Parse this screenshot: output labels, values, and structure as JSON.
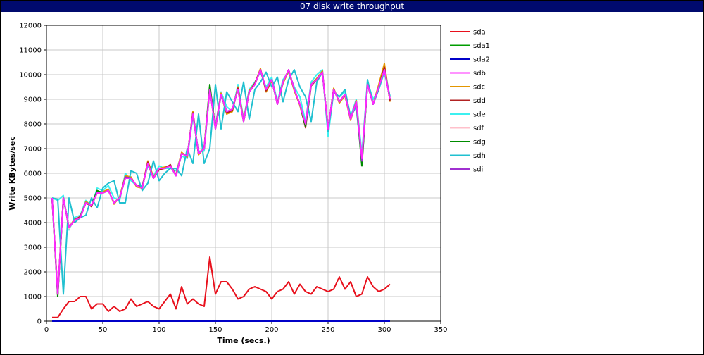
{
  "window": {
    "title": "07 disk write throughput"
  },
  "chart_data": {
    "type": "line",
    "title": "07 disk write throughput",
    "xlabel": "Time (secs.)",
    "ylabel": "Write KBytes/sec",
    "xlim": [
      0,
      350
    ],
    "ylim": [
      0,
      12000
    ],
    "xticks": [
      0,
      50,
      100,
      150,
      200,
      250,
      300,
      350
    ],
    "yticks": [
      0,
      1000,
      2000,
      3000,
      4000,
      5000,
      6000,
      7000,
      8000,
      9000,
      10000,
      11000,
      12000
    ],
    "grid": true,
    "legend_position": "right",
    "x": [
      5,
      10,
      15,
      20,
      25,
      30,
      35,
      40,
      45,
      50,
      55,
      60,
      65,
      70,
      75,
      80,
      85,
      90,
      95,
      100,
      105,
      110,
      115,
      120,
      125,
      130,
      135,
      140,
      145,
      150,
      155,
      160,
      165,
      170,
      175,
      180,
      185,
      190,
      195,
      200,
      205,
      210,
      215,
      220,
      225,
      230,
      235,
      240,
      245,
      250,
      255,
      260,
      265,
      270,
      275,
      280,
      285,
      290,
      295,
      300,
      305
    ],
    "series": [
      {
        "name": "sda",
        "color": "#e8101c",
        "values": [
          150,
          150,
          500,
          800,
          800,
          1000,
          1000,
          500,
          700,
          700,
          400,
          600,
          400,
          500,
          900,
          600,
          700,
          800,
          600,
          500,
          800,
          1100,
          500,
          1400,
          700,
          900,
          700,
          600,
          2600,
          1100,
          1600,
          1600,
          1300,
          900,
          1000,
          1300,
          1400,
          1300,
          1200,
          900,
          1200,
          1300,
          1600,
          1100,
          1500,
          1200,
          1100,
          1400,
          1300,
          1200,
          1300,
          1800,
          1300,
          1600,
          1000,
          1100,
          1800,
          1400,
          1200,
          1300,
          1500
        ]
      },
      {
        "name": "sda1",
        "color": "#009c00",
        "values": [
          0,
          0,
          0,
          0,
          0,
          0,
          0,
          0,
          0,
          0,
          0,
          0,
          0,
          0,
          0,
          0,
          0,
          0,
          0,
          0,
          0,
          0,
          0,
          0,
          0,
          0,
          0,
          0,
          0,
          0,
          0,
          0,
          0,
          0,
          0,
          0,
          0,
          0,
          0,
          0,
          0,
          0,
          0,
          0,
          0,
          0,
          0,
          0,
          0,
          0,
          0,
          0,
          0,
          0,
          0,
          0,
          0,
          0,
          0,
          0,
          0
        ]
      },
      {
        "name": "sda2",
        "color": "#0000c8",
        "values": [
          0,
          0,
          0,
          0,
          0,
          0,
          0,
          0,
          0,
          0,
          0,
          0,
          0,
          0,
          0,
          0,
          0,
          0,
          0,
          0,
          0,
          0,
          0,
          0,
          0,
          0,
          0,
          0,
          0,
          0,
          0,
          0,
          0,
          0,
          0,
          0,
          0,
          0,
          0,
          0,
          0,
          0,
          0,
          0,
          0,
          0,
          0,
          0,
          0,
          0,
          0,
          0,
          0,
          0,
          0,
          0,
          0,
          0,
          0,
          0,
          0
        ]
      },
      {
        "name": "sdb",
        "color": "#ff28ff",
        "values": [
          5000,
          1100,
          5000,
          3800,
          4100,
          4200,
          4800,
          4700,
          5200,
          5200,
          5300,
          4800,
          5000,
          5800,
          5800,
          5500,
          5400,
          6400,
          5800,
          6200,
          6200,
          6300,
          5900,
          6800,
          6700,
          8400,
          6800,
          7000,
          9400,
          7800,
          9200,
          8500,
          8600,
          9400,
          8100,
          9300,
          9600,
          10200,
          9400,
          9800,
          8800,
          9700,
          10200,
          9400,
          8800,
          8000,
          9600,
          9800,
          10100,
          7800,
          9400,
          8900,
          9200,
          8200,
          8900,
          6600,
          9600,
          8800,
          9500,
          10200,
          9000
        ]
      },
      {
        "name": "sdc",
        "color": "#e39600",
        "values": [
          5000,
          1150,
          5000,
          3800,
          4150,
          4200,
          4850,
          4700,
          5250,
          5250,
          5350,
          4750,
          5050,
          5900,
          5850,
          5450,
          5400,
          6500,
          5850,
          6200,
          6250,
          6300,
          5950,
          6850,
          6650,
          8500,
          6750,
          7050,
          9500,
          7850,
          9250,
          8400,
          8500,
          9500,
          8150,
          9350,
          9650,
          10250,
          9300,
          9750,
          8850,
          9650,
          10150,
          9350,
          8750,
          7900,
          9600,
          9850,
          10150,
          7750,
          9450,
          8850,
          9150,
          8150,
          8950,
          6550,
          9650,
          8800,
          9600,
          10450,
          8900
        ]
      },
      {
        "name": "sdd",
        "color": "#b22222",
        "values": [
          5000,
          1050,
          5000,
          3800,
          4100,
          4250,
          4800,
          4650,
          5250,
          5200,
          5300,
          4800,
          5000,
          5850,
          5800,
          5500,
          5450,
          6450,
          5800,
          6150,
          6200,
          6350,
          5900,
          6800,
          6700,
          8450,
          6800,
          7000,
          9450,
          7850,
          9200,
          8450,
          8550,
          9450,
          8100,
          9300,
          9650,
          10200,
          9350,
          9800,
          8800,
          9700,
          10200,
          9400,
          8800,
          7850,
          9550,
          9800,
          10100,
          7800,
          9400,
          8900,
          9200,
          8200,
          8900,
          6400,
          9650,
          8800,
          9500,
          10300,
          8950
        ]
      },
      {
        "name": "sde",
        "color": "#3cf0f0",
        "values": [
          5000,
          4900,
          5100,
          3700,
          4200,
          4300,
          4900,
          4650,
          5400,
          5300,
          5500,
          5000,
          4900,
          6000,
          5700,
          5500,
          5500,
          6300,
          5900,
          6300,
          6200,
          6200,
          6100,
          6700,
          6600,
          8300,
          6900,
          6900,
          9400,
          7900,
          9300,
          8700,
          8500,
          9600,
          8200,
          9400,
          9700,
          10100,
          9500,
          9900,
          8900,
          9800,
          10100,
          9500,
          9100,
          8100,
          9700,
          10000,
          10200,
          7500,
          9300,
          9100,
          9300,
          8300,
          9000,
          6800,
          9700,
          9000,
          9400,
          10100,
          9100
        ]
      },
      {
        "name": "sdf",
        "color": "#ffc0cb",
        "values": [
          5000,
          1100,
          5000,
          3750,
          4150,
          4250,
          4800,
          4700,
          5250,
          5250,
          5300,
          4800,
          5050,
          5850,
          5850,
          5500,
          5400,
          6450,
          5850,
          6200,
          6250,
          6300,
          5950,
          6800,
          6700,
          8450,
          6750,
          7000,
          9500,
          7800,
          9250,
          8450,
          8550,
          9450,
          8100,
          9300,
          9650,
          10200,
          9400,
          9800,
          8800,
          9700,
          10200,
          9400,
          8800,
          7950,
          9600,
          9800,
          10100,
          7800,
          9400,
          8900,
          9200,
          8200,
          8900,
          6500,
          9600,
          8800,
          9550,
          10300,
          9000
        ]
      },
      {
        "name": "sdg",
        "color": "#008c00",
        "values": [
          5000,
          1000,
          5000,
          3800,
          4100,
          4200,
          4800,
          4700,
          5300,
          5200,
          5300,
          4800,
          5000,
          5800,
          5800,
          5500,
          5400,
          6400,
          5800,
          6200,
          6200,
          6300,
          5900,
          6800,
          6700,
          8400,
          6800,
          7000,
          9600,
          7800,
          9200,
          8500,
          8600,
          9400,
          8100,
          9300,
          9600,
          10200,
          9400,
          9800,
          8800,
          9700,
          10200,
          9400,
          8800,
          7900,
          9600,
          9800,
          10100,
          7800,
          9400,
          8900,
          9200,
          8200,
          8900,
          6300,
          9600,
          8800,
          9500,
          10200,
          9000
        ]
      },
      {
        "name": "sdh",
        "color": "#20c0d0",
        "values": [
          5000,
          4950,
          1100,
          5000,
          4000,
          4200,
          4300,
          5000,
          4600,
          5400,
          5600,
          5700,
          4800,
          4800,
          6100,
          6000,
          5300,
          5600,
          6500,
          5700,
          6000,
          6200,
          6200,
          5900,
          7000,
          6400,
          8400,
          6400,
          7000,
          9600,
          7800,
          9300,
          8900,
          8500,
          9700,
          8200,
          9400,
          9700,
          10100,
          9500,
          9900,
          8900,
          9800,
          10200,
          9500,
          9100,
          8100,
          9700,
          10100,
          7700,
          9300,
          9100,
          9400,
          8300,
          8700,
          6500,
          9800,
          8800,
          9400,
          10200,
          9100
        ]
      },
      {
        "name": "sdi",
        "color": "#a030d0",
        "values": [
          5000,
          1100,
          5000,
          3800,
          4100,
          4200,
          4800,
          4700,
          5200,
          5200,
          5300,
          4800,
          5000,
          5850,
          5800,
          5500,
          5400,
          6400,
          5800,
          6200,
          6200,
          6300,
          5900,
          6800,
          6700,
          8400,
          6800,
          7000,
          9400,
          7800,
          9200,
          8500,
          8600,
          9400,
          8100,
          9300,
          9600,
          10200,
          9400,
          9800,
          8800,
          9700,
          10200,
          9400,
          8800,
          8000,
          9600,
          9800,
          10100,
          7800,
          9400,
          8900,
          9200,
          8200,
          8900,
          6500,
          9600,
          8800,
          9500,
          10200,
          9000
        ]
      }
    ]
  }
}
